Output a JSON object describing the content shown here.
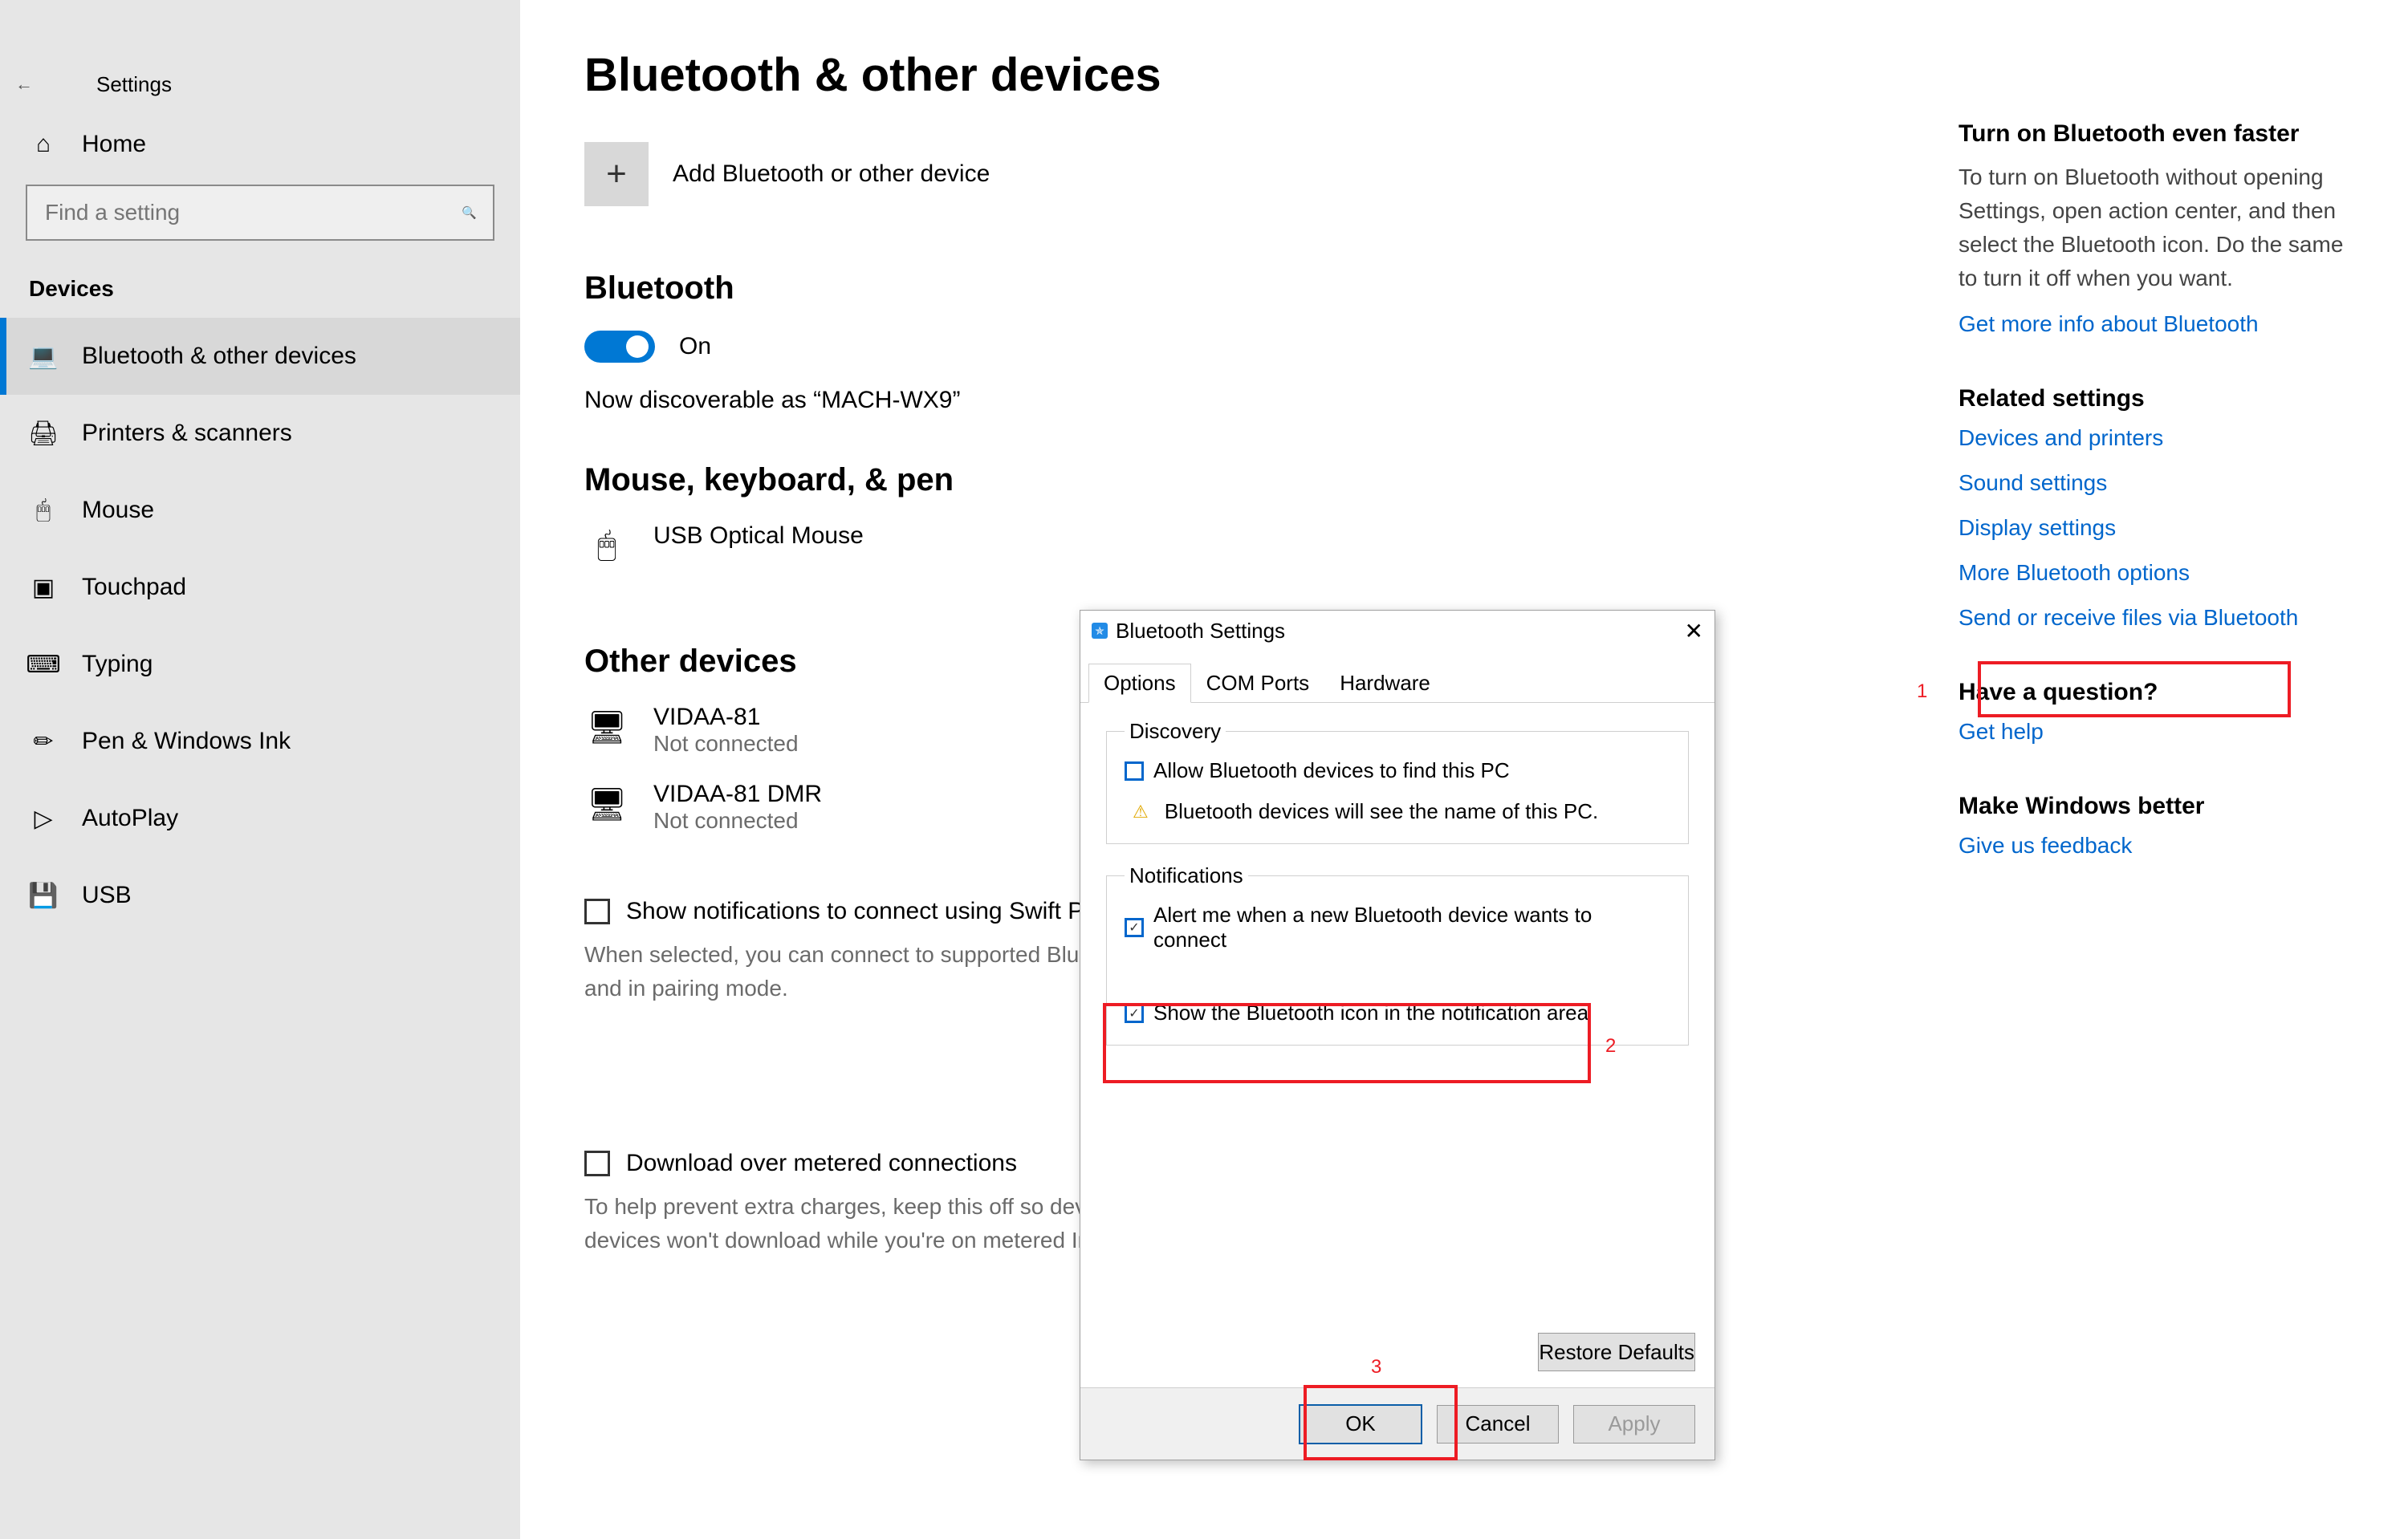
{
  "window": {
    "title": "Settings"
  },
  "search": {
    "placeholder": "Find a setting"
  },
  "category": "Devices",
  "home_label": "Home",
  "nav": [
    {
      "label": "Bluetooth & other devices",
      "selected": true
    },
    {
      "label": "Printers & scanners"
    },
    {
      "label": "Mouse"
    },
    {
      "label": "Touchpad"
    },
    {
      "label": "Typing"
    },
    {
      "label": "Pen & Windows Ink"
    },
    {
      "label": "AutoPlay"
    },
    {
      "label": "USB"
    }
  ],
  "main": {
    "heading": "Bluetooth & other devices",
    "add_device_label": "Add Bluetooth or other device",
    "bluetooth_section": "Bluetooth",
    "toggle_state": "On",
    "discoverable": "Now discoverable as “MACH-WX9”",
    "mouse_section": "Mouse, keyboard, & pen",
    "mouse_device": "USB Optical Mouse",
    "other_section": "Other devices",
    "other": [
      {
        "name": "VIDAA-81",
        "status": "Not connected"
      },
      {
        "name": "VIDAA-81 DMR",
        "status": "Not connected"
      }
    ],
    "swift_pair_title": "Show notifications to connect using Swift Pair",
    "swift_pair_help": "When selected, you can connect to supported Bluetooth devices quickly when they're close by and in pairing mode.",
    "metered_title": "Download over metered connections",
    "metered_help": "To help prevent extra charges, keep this off so device software (drivers, info, and apps) for new devices won't download while you're on metered Internet connections."
  },
  "aside": {
    "tip_title": "Turn on Bluetooth even faster",
    "tip_body": "To turn on Bluetooth without opening Settings, open action center, and then select the Bluetooth icon. Do the same to turn it off when you want.",
    "tip_link": "Get more info about Bluetooth",
    "related_title": "Related settings",
    "related": [
      "Devices and printers",
      "Sound settings",
      "Display settings",
      "More Bluetooth options",
      "Send or receive files via Bluetooth"
    ],
    "question_title": "Have a question?",
    "question_link": "Get help",
    "feedback_title": "Make Windows better",
    "feedback_link": "Give us feedback"
  },
  "dialog": {
    "title": "Bluetooth Settings",
    "tabs": [
      "Options",
      "COM Ports",
      "Hardware"
    ],
    "discovery_legend": "Discovery",
    "discovery_check": "Allow Bluetooth devices to find this PC",
    "discovery_warn": "Bluetooth devices will see the name of this PC.",
    "notif_legend": "Notifications",
    "notif_alert": "Alert me when a new Bluetooth device wants to connect",
    "notif_show_icon": "Show the Bluetooth icon in the notification area",
    "restore": "Restore Defaults",
    "ok": "OK",
    "cancel": "Cancel",
    "apply": "Apply"
  },
  "annotations": {
    "n1": "1",
    "n2": "2",
    "n3": "3"
  }
}
